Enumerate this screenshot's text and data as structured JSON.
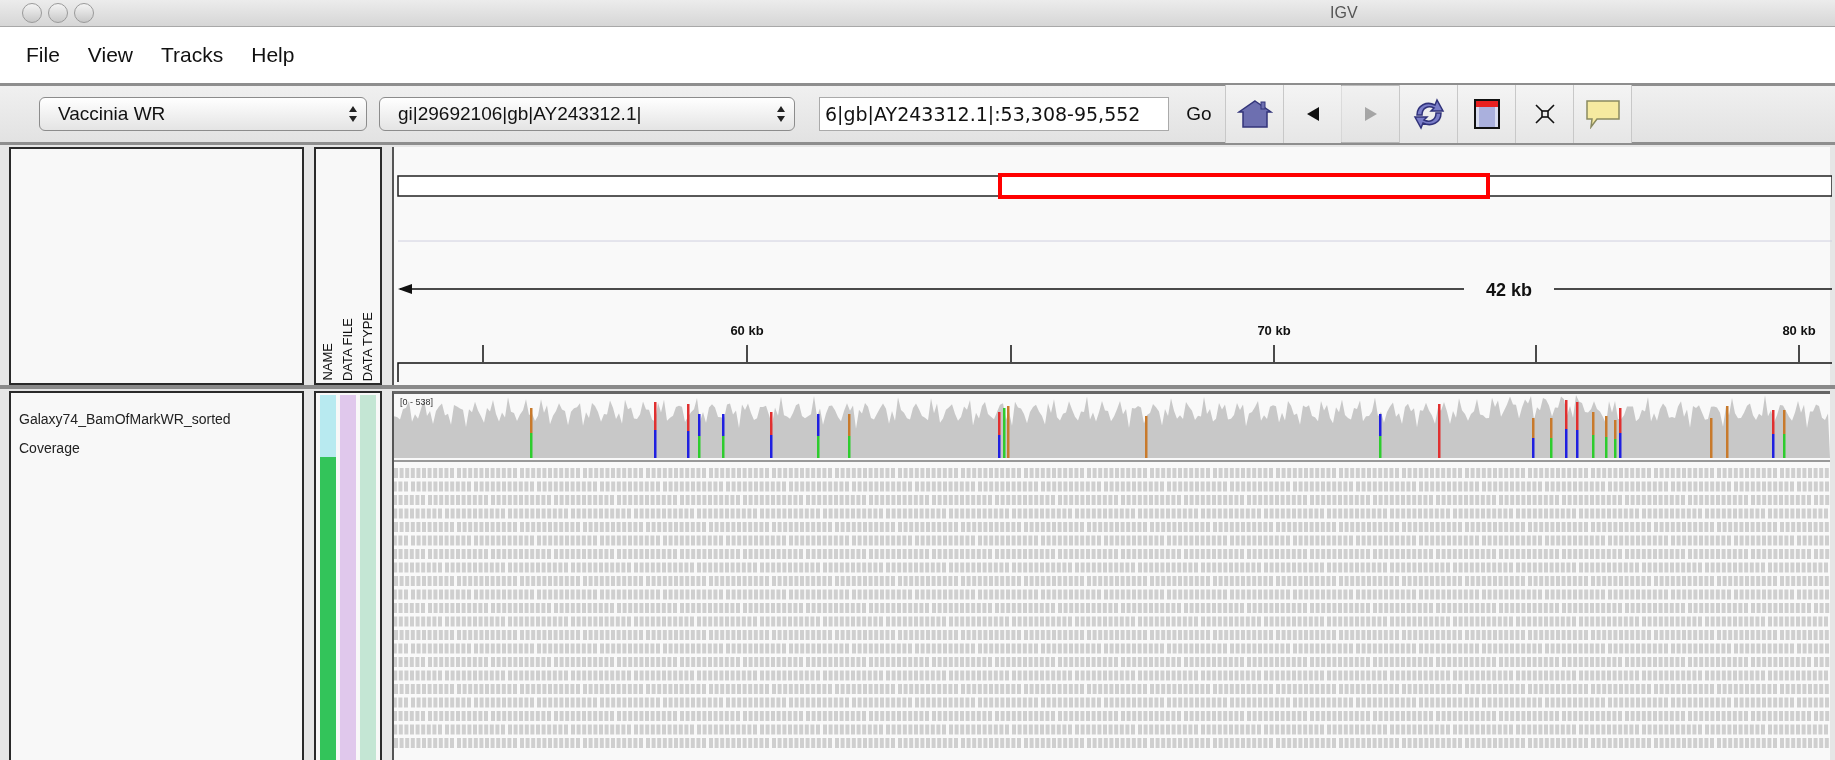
{
  "window": {
    "title": "IGV"
  },
  "menu": [
    "File",
    "View",
    "Tracks",
    "Help"
  ],
  "toolbar": {
    "genome": "Vaccinia WR",
    "chromosome": "gi|29692106|gb|AY243312.1|",
    "locus": "6|gb|AY243312.1|:53,308-95,552",
    "go": "Go",
    "tools": [
      {
        "kind": "home",
        "disabled": false
      },
      {
        "kind": "back",
        "disabled": false
      },
      {
        "kind": "forward",
        "disabled": true
      },
      {
        "kind": "refresh",
        "disabled": false
      },
      {
        "kind": "region",
        "disabled": false
      },
      {
        "kind": "fit",
        "disabled": false
      },
      {
        "kind": "popup",
        "disabled": false
      }
    ]
  },
  "attribute_headers": [
    "NAME",
    "DATA FILE",
    "DATA TYPE"
  ],
  "ruler": {
    "span": "42 kb",
    "tick_labels": [
      "60 kb",
      "70 kb",
      "80 kb"
    ]
  },
  "tracks": [
    {
      "kind": "coverage",
      "name_lines": [
        "Galaxy74_BamOfMarkWR_sorted",
        "Coverage"
      ],
      "range": "[0 - 538]",
      "attributes": [
        {
          "color": "#b8eaf0"
        },
        {
          "color": "#e0c8ec"
        },
        {
          "color": "#c4e6d4"
        }
      ]
    },
    {
      "kind": "alignments",
      "attributes": [
        {
          "color": "#33c45a"
        },
        {
          "color": "#e0c8ec"
        },
        {
          "color": "#c4e6d4"
        }
      ]
    }
  ]
}
